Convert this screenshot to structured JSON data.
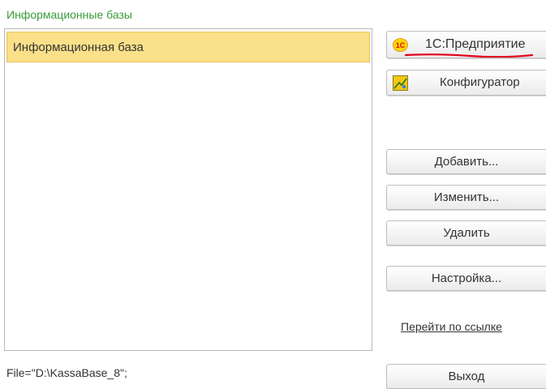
{
  "infobases": {
    "title": "Информационные базы",
    "items": [
      {
        "label": "Информационная база",
        "selected": true
      }
    ],
    "selected_path": "File=\"D:\\KassaBase_8\";"
  },
  "actions": {
    "enterprise_label": "1С:Предприятие",
    "enterprise_icon_text": "1С",
    "configurator_label": "Конфигуратор",
    "add_label": "Добавить...",
    "edit_label": "Изменить...",
    "delete_label": "Удалить",
    "settings_label": "Настройка...",
    "follow_link_label": "Перейти по ссылке",
    "exit_label": "Выход"
  },
  "colors": {
    "title_green": "#3a9a3a",
    "selection_yellow": "#fbe08a",
    "logo_red": "#e30613",
    "logo_yellow": "#ffd700",
    "annotation_red": "#e3001b"
  },
  "icons": {
    "enterprise": "1c-logo-icon",
    "configurator": "configurator-icon"
  }
}
